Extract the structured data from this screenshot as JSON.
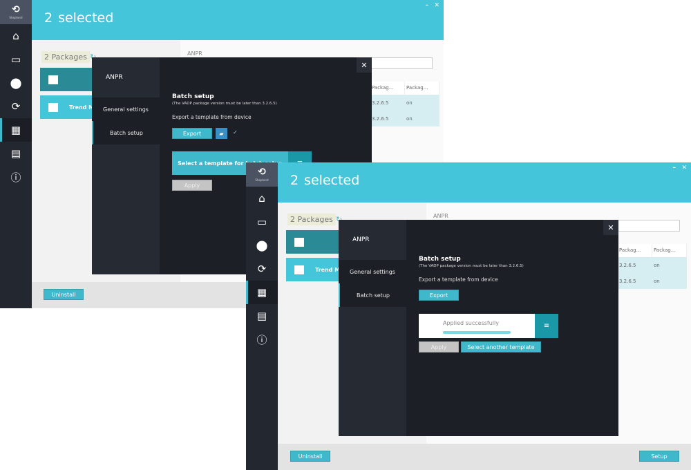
{
  "app": {
    "logo_label": "Shepherd",
    "minimize_icon": "minimize-icon",
    "close_icon": "close-icon"
  },
  "sidebar": {
    "items": [
      {
        "icon": "home-icon",
        "glyph": "⌂"
      },
      {
        "icon": "devices-icon",
        "glyph": "▭"
      },
      {
        "icon": "ip-location-icon",
        "glyph": "⬤"
      },
      {
        "icon": "sync-icon",
        "glyph": "⟳"
      },
      {
        "icon": "apps-grid-icon",
        "glyph": "▦",
        "active": true
      },
      {
        "icon": "export-log-icon",
        "glyph": "▤"
      },
      {
        "icon": "info-icon",
        "glyph": "ⓘ"
      }
    ]
  },
  "header": {
    "count": "2",
    "label": "selected"
  },
  "packages": {
    "count_label": "2 Packages",
    "rows": [
      {
        "name": "",
        "selected": true
      },
      {
        "name": "Trend Mi...",
        "selected": false
      }
    ]
  },
  "detail": {
    "title": "ANPR",
    "table": {
      "headers": [
        "Packag...",
        "Packag..."
      ],
      "rows": [
        [
          "3.2.6.5",
          "on"
        ],
        [
          "3.2.6.5",
          "on"
        ]
      ]
    }
  },
  "footer": {
    "uninstall_label": "Uninstall",
    "setup_label": "Setup"
  },
  "dialog": {
    "app_name": "ANPR",
    "nav": [
      "General settings",
      "Batch setup"
    ],
    "close_glyph": "✕",
    "batch_title": "Batch setup",
    "batch_note": "(The VADP package version must be later than 3.2.6.5)",
    "export_label": "Export a template from device",
    "export_button": "Export",
    "select_template": "Select a template for batch setup",
    "apply_button": "Apply",
    "applied_message": "Applied successfully",
    "applied_progress": 1.0,
    "select_another": "Select another template",
    "menu_glyph": "≡",
    "folder_glyph": "🗁",
    "check_glyph": "✓"
  }
}
